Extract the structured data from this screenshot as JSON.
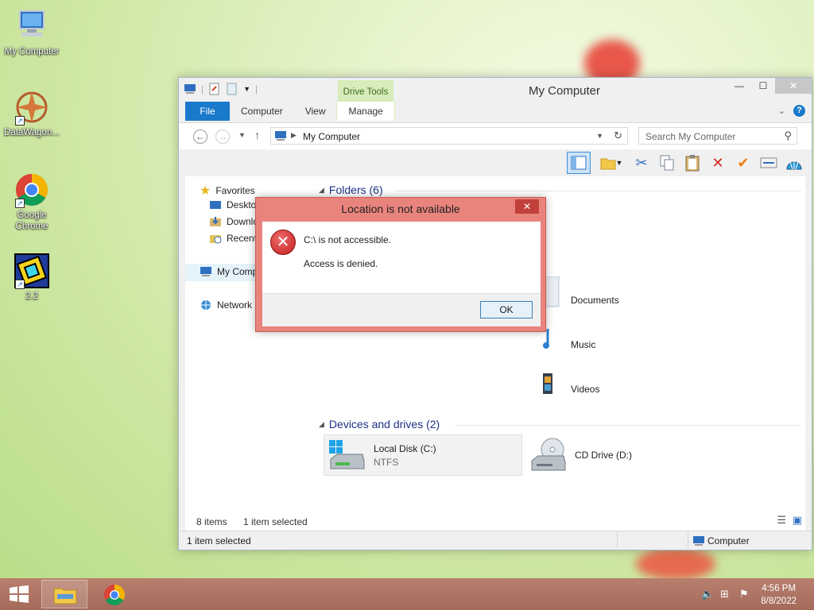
{
  "desktop": {
    "icons": [
      {
        "label": "My Computer"
      },
      {
        "label": "DataWagon..."
      },
      {
        "label": "Google Chrome"
      },
      {
        "label": "2.2"
      }
    ]
  },
  "window": {
    "title": "My Computer",
    "contextual_tab": "Drive Tools",
    "tabs": [
      "File",
      "Computer",
      "View",
      "Manage"
    ],
    "address": "My Computer",
    "search_placeholder": "Search My Computer",
    "nav_pane": {
      "favorites": "Favorites",
      "desktop": "Desktop",
      "downloads": "Downloads",
      "recent": "Recent places",
      "my_computer": "My Computer",
      "network": "Network"
    },
    "folders_header": "Folders (6)",
    "folders": [
      "Documents",
      "Music",
      "Videos"
    ],
    "devices_header": "Devices and drives (2)",
    "drives": [
      {
        "name": "Local Disk (C:)",
        "fs": "NTFS"
      },
      {
        "name": "CD Drive (D:)"
      }
    ],
    "status_items": "8 items",
    "status_selected": "1 item selected",
    "bottom_selected": "1 item selected",
    "bottom_location": "Computer"
  },
  "dialog": {
    "title": "Location is not available",
    "message": "C:\\ is not accessible.",
    "detail": "Access is denied.",
    "ok_label": "OK",
    "close_label": "✕"
  },
  "taskbar": {
    "time": "4:56 PM",
    "date": "8/8/2022"
  },
  "colors": {
    "accent": "#1979ca",
    "dialog_frame": "#e9847c",
    "taskbar": "#b87f6e"
  }
}
